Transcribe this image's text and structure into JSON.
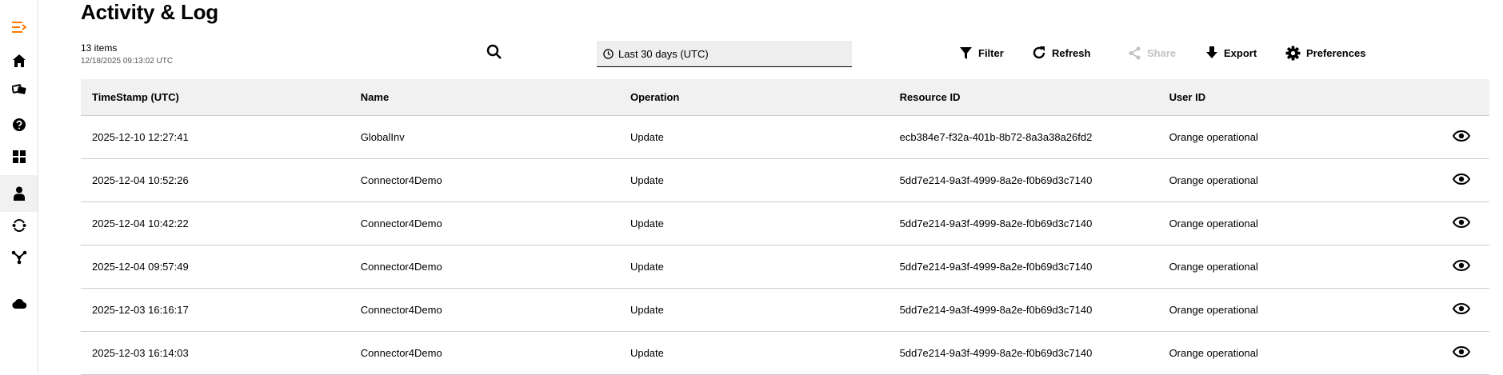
{
  "page": {
    "title": "Activity & Log"
  },
  "summary": {
    "count": "13 items",
    "timestamp": "12/18/2025 09:13:02 UTC"
  },
  "date_range": {
    "value": "Last 30 days (UTC)"
  },
  "toolbar": {
    "filter": "Filter",
    "refresh": "Refresh",
    "share": "Share",
    "export": "Export",
    "preferences": "Preferences"
  },
  "sidebar": {
    "items": [
      {
        "icon": "menu-collapse-icon"
      },
      {
        "icon": "home-icon"
      },
      {
        "icon": "tickets-icon"
      },
      {
        "icon": "help-icon"
      },
      {
        "icon": "dashboard-grid-icon"
      },
      {
        "icon": "user-icon",
        "active": true
      },
      {
        "icon": "sync-icon"
      },
      {
        "icon": "network-icon"
      },
      {
        "icon": "cloud-icon"
      }
    ]
  },
  "table": {
    "columns": [
      "TimeStamp (UTC)",
      "Name",
      "Operation",
      "Resource ID",
      "User ID"
    ],
    "rows": [
      [
        "2025-12-10 12:27:41",
        "GlobalInv",
        "Update",
        "ecb384e7-f32a-401b-8b72-8a3a38a26fd2",
        "Orange operational"
      ],
      [
        "2025-12-04 10:52:26",
        "Connector4Demo",
        "Update",
        "5dd7e214-9a3f-4999-8a2e-f0b69d3c7140",
        "Orange operational"
      ],
      [
        "2025-12-04 10:42:22",
        "Connector4Demo",
        "Update",
        "5dd7e214-9a3f-4999-8a2e-f0b69d3c7140",
        "Orange operational"
      ],
      [
        "2025-12-04 09:57:49",
        "Connector4Demo",
        "Update",
        "5dd7e214-9a3f-4999-8a2e-f0b69d3c7140",
        "Orange operational"
      ],
      [
        "2025-12-03 16:16:17",
        "Connector4Demo",
        "Update",
        "5dd7e214-9a3f-4999-8a2e-f0b69d3c7140",
        "Orange operational"
      ],
      [
        "2025-12-03 16:14:03",
        "Connector4Demo",
        "Update",
        "5dd7e214-9a3f-4999-8a2e-f0b69d3c7140",
        "Orange operational"
      ]
    ]
  },
  "colors": {
    "accent": "#ff7900",
    "header_bg": "#f1f1f1",
    "disabled": "#c2c2c2"
  }
}
